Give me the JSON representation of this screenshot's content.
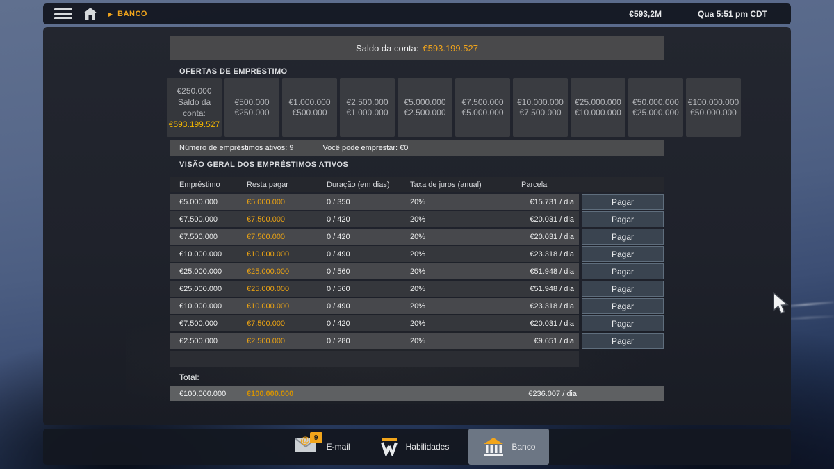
{
  "colors": {
    "accent_yellow": "#f0a41c",
    "value_orange": "#eba313",
    "panel_dark": "#1f222b",
    "row_light": "#47484c",
    "row_dark": "#35373c",
    "selected_tab": "#6c7684"
  },
  "topbar": {
    "breadcrumb": "BANCO",
    "balance": "€593,2M",
    "datetime": "Qua 5:51 pm CDT"
  },
  "account": {
    "balance_label": "Saldo da conta:",
    "balance_value": "€593.199.527"
  },
  "offers": {
    "title": "OFERTAS DE EMPRÉSTIMO",
    "cards": [
      {
        "line1": "€250.000",
        "line2": "Saldo da conta:",
        "highlight": "€593.199.527"
      },
      {
        "line1": "€500.000",
        "line2": "€250.000"
      },
      {
        "line1": "€1.000.000",
        "line2": "€500.000"
      },
      {
        "line1": "€2.500.000",
        "line2": "€1.000.000"
      },
      {
        "line1": "€5.000.000",
        "line2": "€2.500.000"
      },
      {
        "line1": "€7.500.000",
        "line2": "€5.000.000"
      },
      {
        "line1": "€10.000.000",
        "line2": "€7.500.000"
      },
      {
        "line1": "€25.000.000",
        "line2": "€10.000.000"
      },
      {
        "line1": "€50.000.000",
        "line2": "€25.000.000"
      },
      {
        "line1": "€100.000.000",
        "line2": "€50.000.000"
      }
    ]
  },
  "summary": {
    "active_label": "Número de empréstimos ativos: 9",
    "can_borrow_label": "Você pode emprestar: €0"
  },
  "loans": {
    "title": "VISÃO GERAL DOS EMPRÉSTIMOS ATIVOS",
    "headers": {
      "amount": "Empréstimo",
      "remaining": "Resta pagar",
      "duration": "Duração (em dias)",
      "rate": "Taxa de juros (anual)",
      "installment": "Parcela"
    },
    "pay_label": "Pagar",
    "rows": [
      {
        "amount": "€5.000.000",
        "remaining": "€5.000.000",
        "duration": "0 / 350",
        "rate": "20%",
        "installment": "€15.731 / dia"
      },
      {
        "amount": "€7.500.000",
        "remaining": "€7.500.000",
        "duration": "0 / 420",
        "rate": "20%",
        "installment": "€20.031 / dia"
      },
      {
        "amount": "€7.500.000",
        "remaining": "€7.500.000",
        "duration": "0 / 420",
        "rate": "20%",
        "installment": "€20.031 / dia"
      },
      {
        "amount": "€10.000.000",
        "remaining": "€10.000.000",
        "duration": "0 / 490",
        "rate": "20%",
        "installment": "€23.318 / dia"
      },
      {
        "amount": "€25.000.000",
        "remaining": "€25.000.000",
        "duration": "0 / 560",
        "rate": "20%",
        "installment": "€51.948 / dia"
      },
      {
        "amount": "€25.000.000",
        "remaining": "€25.000.000",
        "duration": "0 / 560",
        "rate": "20%",
        "installment": "€51.948 / dia"
      },
      {
        "amount": "€10.000.000",
        "remaining": "€10.000.000",
        "duration": "0 / 490",
        "rate": "20%",
        "installment": "€23.318 / dia"
      },
      {
        "amount": "€7.500.000",
        "remaining": "€7.500.000",
        "duration": "0 / 420",
        "rate": "20%",
        "installment": "€20.031 / dia"
      },
      {
        "amount": "€2.500.000",
        "remaining": "€2.500.000",
        "duration": "0 / 280",
        "rate": "20%",
        "installment": "€9.651 / dia"
      }
    ],
    "total": {
      "label": "Total:",
      "amount": "€100.000.000",
      "remaining": "€100.000.000",
      "installment": "€236.007 / dia"
    }
  },
  "dock": {
    "email_label": "E-mail",
    "email_badge": "9",
    "skills_label": "Habilidades",
    "bank_label": "Banco"
  }
}
